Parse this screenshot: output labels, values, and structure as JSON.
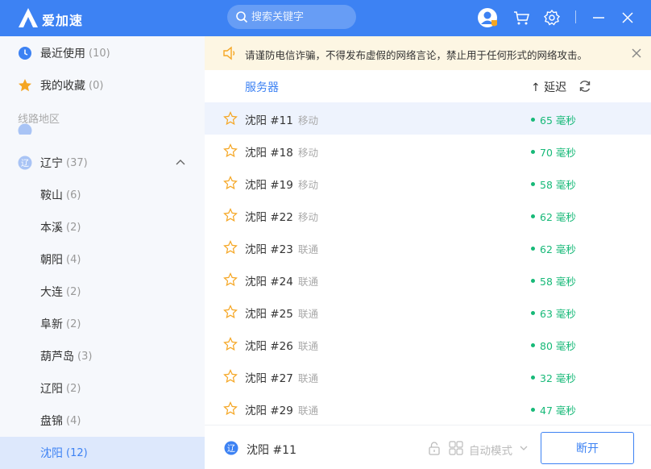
{
  "app": {
    "brand": "爱加速"
  },
  "search": {
    "placeholder": "搜索关键字"
  },
  "sidebar": {
    "recent": {
      "label": "最近使用",
      "count": "(10)"
    },
    "favorites": {
      "label": "我的收藏",
      "count": "(0)"
    },
    "section_label": "线路地区",
    "province": {
      "label": "辽宁",
      "count": "(37)"
    },
    "cities": [
      {
        "label": "鞍山",
        "count": "(6)"
      },
      {
        "label": "本溪",
        "count": "(2)"
      },
      {
        "label": "朝阳",
        "count": "(4)"
      },
      {
        "label": "大连",
        "count": "(2)"
      },
      {
        "label": "阜新",
        "count": "(2)"
      },
      {
        "label": "葫芦岛",
        "count": "(3)"
      },
      {
        "label": "辽阳",
        "count": "(2)"
      },
      {
        "label": "盘锦",
        "count": "(4)"
      },
      {
        "label": "沈阳",
        "count": "(12)"
      }
    ],
    "province_badge": "辽"
  },
  "notice": {
    "text": "请谨防电信诈骗，不得发布虚假的网络言论，禁止用于任何形式的网络攻击。"
  },
  "list": {
    "col_server": "服务器",
    "col_delay": "↑ 延迟",
    "rows": [
      {
        "name": "沈阳 #11",
        "isp": "移动",
        "latency": "65 毫秒"
      },
      {
        "name": "沈阳 #18",
        "isp": "移动",
        "latency": "70 毫秒"
      },
      {
        "name": "沈阳 #19",
        "isp": "移动",
        "latency": "58 毫秒"
      },
      {
        "name": "沈阳 #22",
        "isp": "移动",
        "latency": "62 毫秒"
      },
      {
        "name": "沈阳 #23",
        "isp": "联通",
        "latency": "62 毫秒"
      },
      {
        "name": "沈阳 #24",
        "isp": "联通",
        "latency": "58 毫秒"
      },
      {
        "name": "沈阳 #25",
        "isp": "联通",
        "latency": "63 毫秒"
      },
      {
        "name": "沈阳 #26",
        "isp": "联通",
        "latency": "80 毫秒"
      },
      {
        "name": "沈阳 #27",
        "isp": "联通",
        "latency": "32 毫秒"
      },
      {
        "name": "沈阳 #29",
        "isp": "联通",
        "latency": "47 毫秒"
      }
    ]
  },
  "bottom": {
    "current_server": "沈阳 #11",
    "mode_label": "自动模式",
    "disconnect_label": "断开"
  },
  "colors": {
    "accent": "#3d82f3",
    "latency_good": "#17b978",
    "notice_bg": "#fdf6e3",
    "star": "#f5a623"
  }
}
